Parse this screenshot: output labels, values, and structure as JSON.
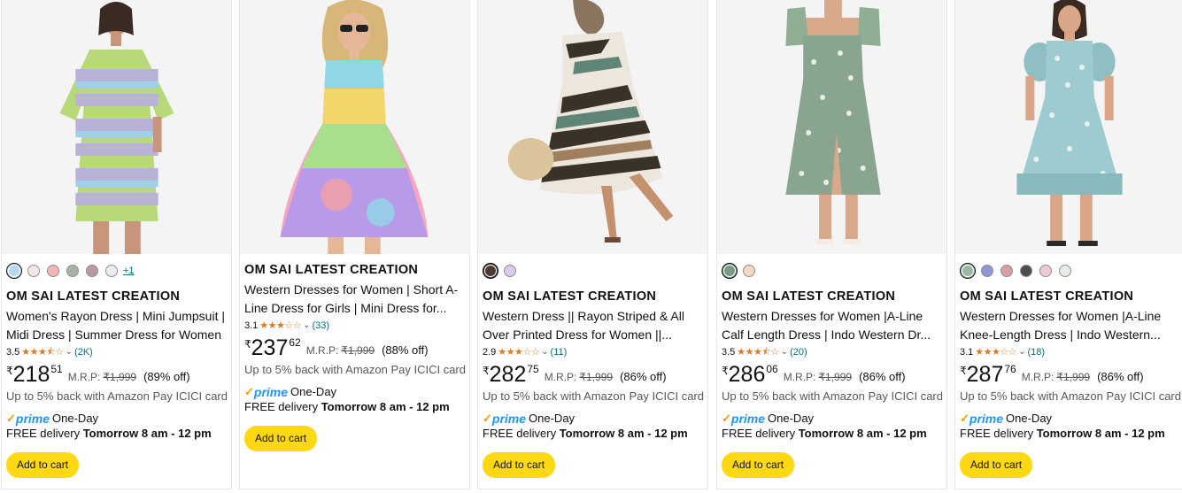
{
  "products": [
    {
      "image": "striped-pastel-tshirt-dress",
      "swatches": [
        "#b9d8f0",
        "#f3e6e6",
        "#f2b6b6",
        "#a9b2a6",
        "#b89aa0",
        "#ececec"
      ],
      "more_colors": "+1",
      "brand": "OM SAI LATEST CREATION",
      "title": "Women's Rayon Dress | Mini Jumpsuit | Midi Dress | Summer Dress for Women",
      "rating_value": "3.5",
      "rating_stars": 3.5,
      "rating_count": "(2K)",
      "currency": "₹",
      "price_whole": "218",
      "price_fraction": "51",
      "mrp_label": "M.R.P:",
      "mrp_value": "₹1,999",
      "discount": "(89% off)",
      "cashback": "Up to 5% back with Amazon Pay ICICI card",
      "prime_check": "✓",
      "prime_word": "prime",
      "prime_speed": "One-Day",
      "delivery_prefix": "FREE delivery",
      "delivery_time": "Tomorrow 8 am - 12 pm",
      "cart_label": "Add to cart"
    },
    {
      "image": "tie-dye-skater-dress",
      "swatches": [],
      "more_colors": "",
      "brand": "OM SAI LATEST CREATION",
      "title": "Western Dresses for Women | Short A-Line Dress for Girls | Mini Dress for...",
      "rating_value": "3.1",
      "rating_stars": 3.0,
      "rating_count": "(33)",
      "currency": "₹",
      "price_whole": "237",
      "price_fraction": "62",
      "mrp_label": "M.R.P:",
      "mrp_value": "₹1,999",
      "discount": "(88% off)",
      "cashback": "Up to 5% back with Amazon Pay ICICI card",
      "prime_check": "✓",
      "prime_word": "prime",
      "prime_speed": "One-Day",
      "delivery_prefix": "FREE delivery",
      "delivery_time": "Tomorrow 8 am - 12 pm",
      "cart_label": "Add to cart"
    },
    {
      "image": "brown-abstract-print-dress",
      "swatches": [
        "#4a3a33",
        "#d7cde6"
      ],
      "more_colors": "",
      "brand": "OM SAI LATEST CREATION",
      "title": "Western Dress || Rayon Striped & All Over Printed Dress for Women ||...",
      "rating_value": "2.9",
      "rating_stars": 3.0,
      "rating_count": "(11)",
      "currency": "₹",
      "price_whole": "282",
      "price_fraction": "75",
      "mrp_label": "M.R.P:",
      "mrp_value": "₹1,999",
      "discount": "(86% off)",
      "cashback": "Up to 5% back with Amazon Pay ICICI card",
      "prime_check": "✓",
      "prime_word": "prime",
      "prime_speed": "One-Day",
      "delivery_prefix": "FREE delivery",
      "delivery_time": "Tomorrow 8 am - 12 pm",
      "cart_label": "Add to cart"
    },
    {
      "image": "green-floral-midi-dress",
      "swatches": [
        "#7b9a83",
        "#f3d7c2"
      ],
      "more_colors": "",
      "brand": "OM SAI LATEST CREATION",
      "title": "Western Dresses for Women |A-Line Calf Length Dress | Indo Western Dr...",
      "rating_value": "3.5",
      "rating_stars": 3.5,
      "rating_count": "(20)",
      "currency": "₹",
      "price_whole": "286",
      "price_fraction": "06",
      "mrp_label": "M.R.P:",
      "mrp_value": "₹1,999",
      "discount": "(86% off)",
      "cashback": "Up to 5% back with Amazon Pay ICICI card",
      "prime_check": "✓",
      "prime_word": "prime",
      "prime_speed": "One-Day",
      "delivery_prefix": "FREE delivery",
      "delivery_time": "Tomorrow 8 am - 12 pm",
      "cart_label": "Add to cart"
    },
    {
      "image": "aqua-floral-puff-sleeve-dress",
      "swatches": [
        "#9bb6a4",
        "#8d96d6",
        "#d89ea4",
        "#4d4d50",
        "#eec8d2",
        "#e7ece6"
      ],
      "more_colors": "",
      "brand": "OM SAI LATEST CREATION",
      "title": "Western Dresses for Women |A-Line Knee-Length Dress | Indo Western...",
      "rating_value": "3.1",
      "rating_stars": 3.0,
      "rating_count": "(18)",
      "currency": "₹",
      "price_whole": "287",
      "price_fraction": "76",
      "mrp_label": "M.R.P:",
      "mrp_value": "₹1,999",
      "discount": "(86% off)",
      "cashback": "Up to 5% back with Amazon Pay ICICI card",
      "prime_check": "✓",
      "prime_word": "prime",
      "prime_speed": "One-Day",
      "delivery_prefix": "FREE delivery",
      "delivery_time": "Tomorrow 8 am - 12 pm",
      "cart_label": "Add to cart"
    }
  ]
}
